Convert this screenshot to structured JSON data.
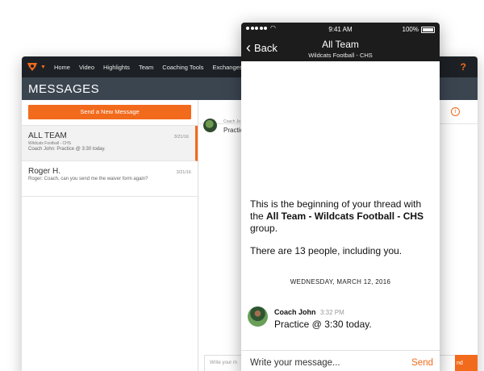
{
  "desktop": {
    "nav_items": [
      "Home",
      "Video",
      "Highlights",
      "Team",
      "Coaching Tools",
      "Exchanges"
    ],
    "help_label": "?",
    "page_title": "MESSAGES",
    "new_message_label": "Send a New Message",
    "threads": [
      {
        "name": "ALL TEAM",
        "subtitle": "Wildcats Football - CHS",
        "preview": "Coach John: Practice @ 3:30 today.",
        "date": "3/21/16"
      },
      {
        "name": "Roger H.",
        "subtitle": "",
        "preview": "Roger: Coach, can you send me the waiver form again?",
        "date": "3/21/16"
      }
    ],
    "info_label": "i",
    "message_author_partial": "Coach Jo",
    "message_text_partial": "Practic",
    "input_placeholder_partial": "Write your m",
    "send_partial": "nd"
  },
  "phone": {
    "status": {
      "time": "9:41 AM",
      "battery": "100%"
    },
    "back_label": "Back",
    "title": "All Team",
    "subtitle": "Wildcats Football - CHS",
    "intro_prefix": "This is the beginning of your thread with the ",
    "intro_group": "All Team - Wildcats Football - CHS",
    "intro_suffix": " group.",
    "people_count_text": "There are 13 people, including you.",
    "date_separator": "WEDNESDAY, MARCH 12, 2016",
    "message": {
      "author": "Coach John",
      "time": "3:32 PM",
      "text": "Practice @ 3:30 today."
    },
    "composer_placeholder": "Write your message...",
    "send_label": "Send"
  },
  "colors": {
    "accent": "#f26a1b",
    "nav_dark": "#1d2125",
    "title_bar": "#3b4550"
  }
}
